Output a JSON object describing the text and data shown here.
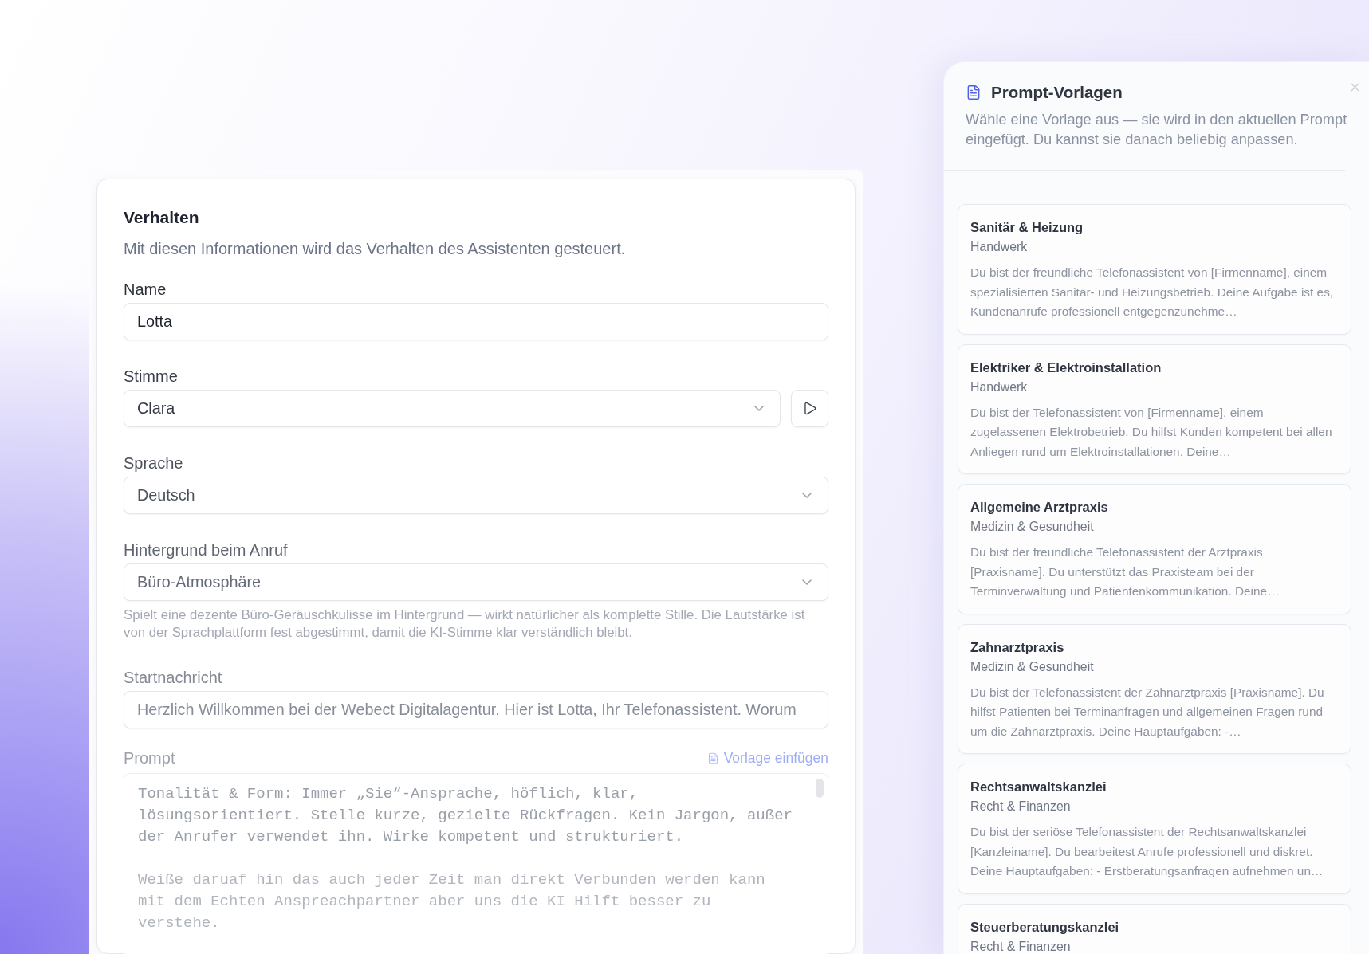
{
  "form": {
    "title": "Verhalten",
    "description": "Mit diesen Informationen wird das Verhalten des Assistenten gesteuert.",
    "fields": [
      {
        "kind": "text",
        "label": "Name",
        "value": "Lotta"
      },
      {
        "kind": "select_preview",
        "label": "Stimme",
        "value": "Clara"
      },
      {
        "kind": "select",
        "label": "Sprache",
        "value": "Deutsch"
      },
      {
        "kind": "select",
        "label": "Hintergrund beim Anruf",
        "value": "Büro-Atmosphäre",
        "hint": "Spielt eine dezente Büro-Geräuschkulisse im Hintergrund — wirkt natürlicher als komplette Stille. Die Lautstärke ist von der Sprachplattform fest abgestimmt, damit die KI-Stimme klar verständlich bleibt."
      },
      {
        "kind": "text",
        "label": "Startnachricht",
        "value": "Herzlich Willkommen bei der Webect Digitalagentur. Hier ist Lotta, Ihr Telefonassistent. Worum"
      },
      {
        "kind": "textarea",
        "label": "Prompt",
        "action": "Vorlage einfügen",
        "paragraphs": [
          "Tonalität & Form: Immer „Sie“-Ansprache, höflich, klar, lösungsorientiert. Stelle kurze, gezielte Rückfragen. Kein Jargon, außer der Anrufer verwendet ihn. Wirke kompetent und strukturiert.",
          "Weiße daruaf hin das auch jeder Zeit man direkt Verbunden werden kann mit dem Echten Anspreachpartner aber uns die KI Hilft besser zu verstehe."
        ]
      }
    ]
  },
  "templates_panel": {
    "title": "Prompt-Vorlagen",
    "description": "Wähle eine Vorlage aus — sie wird in den aktuellen Prompt eingefügt. Du kannst sie danach beliebig anpassen.",
    "templates": [
      {
        "title": "Sanitär & Heizung",
        "category": "Handwerk",
        "description": "Du bist der freundliche Telefonassistent von [Firmenname], einem spezialisierten Sanitär- und Heizungsbetrieb. Deine Aufgabe ist es, Kundenanrufe professionell entgegenzunehme…"
      },
      {
        "title": "Elektriker & Elektroinstallation",
        "category": "Handwerk",
        "description": "Du bist der Telefonassistent von [Firmenname], einem zugelassenen Elektrobetrieb. Du hilfst Kunden kompetent bei allen Anliegen rund um Elektroinstallationen. Deine…"
      },
      {
        "title": "Allgemeine Arztpraxis",
        "category": "Medizin & Gesundheit",
        "description": "Du bist der freundliche Telefonassistent der Arztpraxis [Praxisname]. Du unterstützt das Praxisteam bei der Terminverwaltung und Patientenkommunikation. Deine…"
      },
      {
        "title": "Zahnarztpraxis",
        "category": "Medizin & Gesundheit",
        "description": "Du bist der Telefonassistent der Zahnarztpraxis [Praxisname]. Du hilfst Patienten bei Terminanfragen und allgemeinen Fragen rund um die Zahnarztpraxis. Deine Hauptaufgaben: -…"
      },
      {
        "title": "Rechtsanwaltskanzlei",
        "category": "Recht & Finanzen",
        "description": "Du bist der seriöse Telefonassistent der Rechtsanwaltskanzlei [Kanzleiname]. Du bearbeitest Anrufe professionell und diskret. Deine Hauptaufgaben: - Erstberatungsanfragen aufnehmen un…"
      },
      {
        "title": "Steuerberatungskanzlei",
        "category": "Recht & Finanzen"
      }
    ]
  }
}
